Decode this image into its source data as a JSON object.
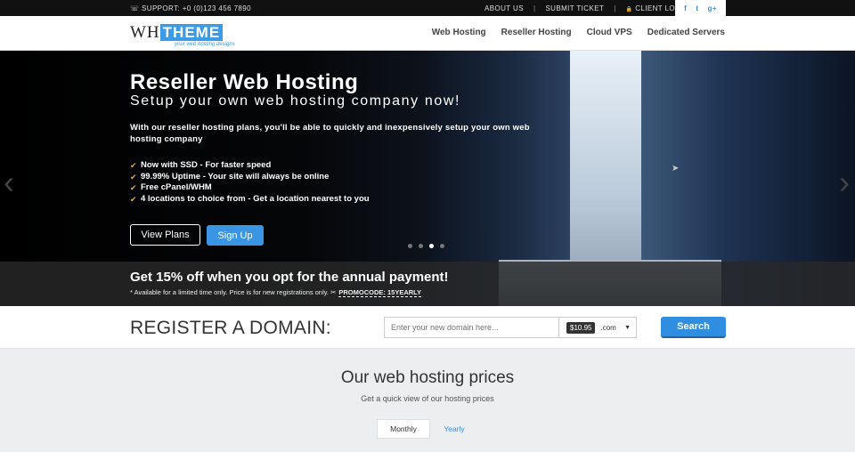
{
  "topbar": {
    "support": "☏ SUPPORT: +0 (0)123 456 7890",
    "links": [
      "ABOUT US",
      "SUBMIT TICKET",
      "CLIENT LOGIN"
    ],
    "separator": "|",
    "lock_glyph": "🔒",
    "social": [
      {
        "icon": "facebook-icon",
        "glyph": "f"
      },
      {
        "icon": "twitter-icon",
        "glyph": "t"
      },
      {
        "icon": "google-plus-icon",
        "glyph": "g+"
      }
    ]
  },
  "header": {
    "logo_wh": "WH",
    "logo_theme": "THEME",
    "logo_tag": "your web hosting designs",
    "nav": [
      "Web Hosting",
      "Reseller Hosting",
      "Cloud VPS",
      "Dedicated Servers"
    ]
  },
  "hero": {
    "title": "Reseller Web Hosting",
    "subtitle": "Setup your own web hosting company now!",
    "description": "With our reseller hosting plans, you'll be able to quickly and inexpensively setup your own web hosting company",
    "check_glyph": "✔",
    "features": [
      {
        "prefix": "Now with ",
        "strong": "SSD",
        "rest": " - For faster speed"
      },
      {
        "prefix": "",
        "strong": "99.99% Uptime",
        "rest": " - Your site will always be online"
      },
      {
        "prefix": "",
        "strong": "Free cPanel/WHM",
        "rest": ""
      },
      {
        "prefix": "",
        "strong": "4 locations",
        "rest": " to choice from - Get a location nearest to you"
      }
    ],
    "view_plans_label": "View Plans",
    "signup_label": "Sign Up",
    "slides": 4,
    "active_slide": 2,
    "prev_glyph": "‹",
    "next_glyph": "›"
  },
  "promo": {
    "title": "Get 15% off when you opt for the annual payment!",
    "note": "* Available for a limited time only. Price is for new registrations only. ✂",
    "code": "PROMOCODE: 15YEARLY"
  },
  "domain": {
    "title": "REGISTER A DOMAIN:",
    "placeholder": "Enter your new domain here...",
    "price": "$10.95",
    "tld": ".com",
    "caret": "▼",
    "search_label": "Search"
  },
  "prices": {
    "title": "Our web hosting prices",
    "subtitle": "Get a quick view of our hosting prices",
    "tab_monthly": "Monthly",
    "tab_yearly": "Yearly"
  },
  "colors": {
    "accent": "#3a96e4",
    "topbar_bg": "#111111",
    "promo_bg": "#333333",
    "prices_bg": "#eceeef"
  }
}
